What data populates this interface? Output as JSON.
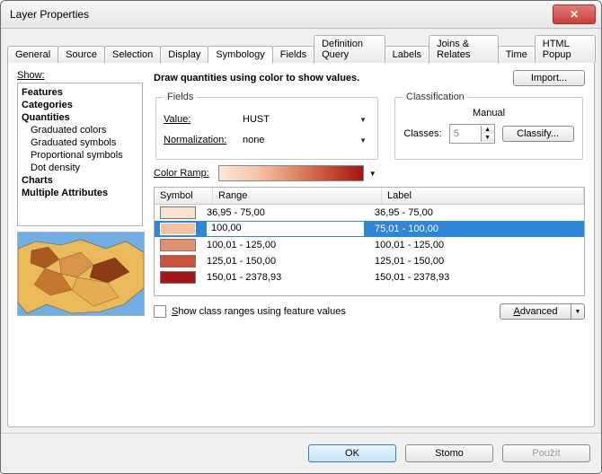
{
  "window": {
    "title": "Layer Properties"
  },
  "tabs": [
    "General",
    "Source",
    "Selection",
    "Display",
    "Symbology",
    "Fields",
    "Definition Query",
    "Labels",
    "Joins & Relates",
    "Time",
    "HTML Popup"
  ],
  "active_tab": "Symbology",
  "show": {
    "label": "Show:",
    "tree": {
      "features": "Features",
      "categories": "Categories",
      "quantities": {
        "label": "Quantities",
        "children": [
          "Graduated colors",
          "Graduated symbols",
          "Proportional symbols",
          "Dot density"
        ],
        "selected": "Graduated colors"
      },
      "charts": "Charts",
      "multiple": "Multiple Attributes"
    }
  },
  "heading": "Draw quantities using color to show values.",
  "import_btn": "Import...",
  "fields": {
    "legend": "Fields",
    "value_label": "Value:",
    "value": "HUST",
    "norm_label": "Normalization:",
    "norm": "none"
  },
  "classification": {
    "legend": "Classification",
    "method": "Manual",
    "classes_label": "Classes:",
    "classes": "5",
    "classify_btn": "Classify..."
  },
  "ramp_label": "Color Ramp:",
  "grid": {
    "headers": {
      "symbol": "Symbol",
      "range": "Range",
      "label": "Label"
    },
    "rows": [
      {
        "color": "#fbe2cd",
        "range": "36,95 - 75,00",
        "label": "36,95 - 75,00"
      },
      {
        "color": "#f4c2a0",
        "range": "100,00",
        "label": "75,01 - 100,00",
        "selected": true
      },
      {
        "color": "#e0916d",
        "range": "100,01 - 125,00",
        "label": "100,01 - 125,00"
      },
      {
        "color": "#c95238",
        "range": "125,01 - 150,00",
        "label": "125,01 - 150,00"
      },
      {
        "color": "#a51717",
        "range": "150,01 - 2378,93",
        "label": "150,01 - 2378,93"
      }
    ]
  },
  "show_ranges_chk": "Show class ranges using feature values",
  "advanced_btn": "Advanced",
  "footer": {
    "ok": "OK",
    "cancel": "Stomo",
    "apply": "Použít"
  }
}
